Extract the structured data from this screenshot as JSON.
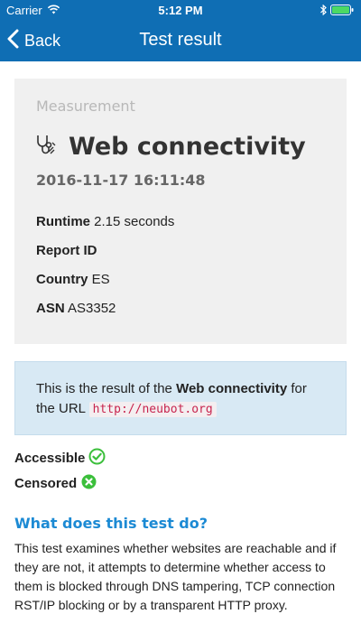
{
  "status_bar": {
    "carrier": "Carrier",
    "time": "5:12 PM"
  },
  "nav": {
    "back_label": "Back",
    "title": "Test result"
  },
  "card": {
    "kicker": "Measurement",
    "title": "Web connectivity",
    "date": "2016-11-17 16:11:48",
    "runtime_label": "Runtime",
    "runtime_value": "2.15 seconds",
    "report_label": "Report ID",
    "report_value": "",
    "country_label": "Country",
    "country_value": "ES",
    "asn_label": "ASN",
    "asn_value": "AS3352"
  },
  "info": {
    "prefix": "This is the result of the",
    "test_name": "Web connectivity",
    "for_text": "for",
    "url_prefix": "the URL",
    "url": "http://neubot.org"
  },
  "results": {
    "accessible_label": "Accessible",
    "censored_label": "Censored"
  },
  "explain": {
    "heading": "What does this test do?",
    "body": "This test examines whether websites are reachable and if they are not, it attempts to determine whether access to them is blocked through DNS tampering, TCP connection RST/IP blocking or by a transparent HTTP proxy."
  },
  "colors": {
    "nav_bg": "#0f6eb4",
    "accessible": "#3bbf3b",
    "censored": "#3bbf3b",
    "heading": "#1c8ad4",
    "battery": "#4cd964"
  }
}
